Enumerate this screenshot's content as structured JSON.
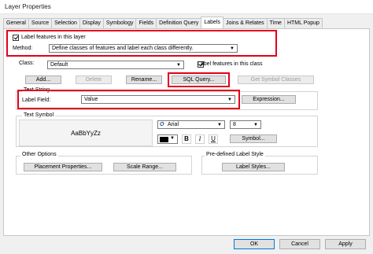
{
  "window": {
    "title": "Layer Properties"
  },
  "tabs": [
    "General",
    "Source",
    "Selection",
    "Display",
    "Symbology",
    "Fields",
    "Definition Query",
    "Labels",
    "Joins & Relates",
    "Time",
    "HTML Popup"
  ],
  "active_tab": "Labels",
  "label_features_in_layer": "Label features in this layer",
  "method": {
    "label": "Method:",
    "value": "Define classes of features and label each class differently."
  },
  "class_row": {
    "label": "Class:",
    "value": "Default",
    "label_features_in_class": "Label features in this class"
  },
  "buttons": {
    "add": "Add...",
    "delete": "Delete",
    "rename": "Rename...",
    "sql_query": "SQL Query...",
    "get_symbol_classes": "Get Symbol Classes",
    "expression": "Expression...",
    "symbol": "Symbol...",
    "placement_properties": "Placement Properties...",
    "scale_range": "Scale Range...",
    "label_styles": "Label Styles...",
    "ok": "OK",
    "cancel": "Cancel",
    "apply": "Apply"
  },
  "text_string": {
    "title": "Text String",
    "label_field_label": "Label Field:",
    "label_field_value": "Value"
  },
  "text_symbol": {
    "title": "Text Symbol",
    "preview": "AaBbYyZz",
    "font": "Arial",
    "size": "8",
    "bold": "B",
    "italic": "I",
    "underline": "U",
    "color": "#000000"
  },
  "other_options": {
    "title": "Other Options"
  },
  "predefined_style": {
    "title": "Pre-defined Label Style"
  },
  "highlight_color": "#e3001b"
}
